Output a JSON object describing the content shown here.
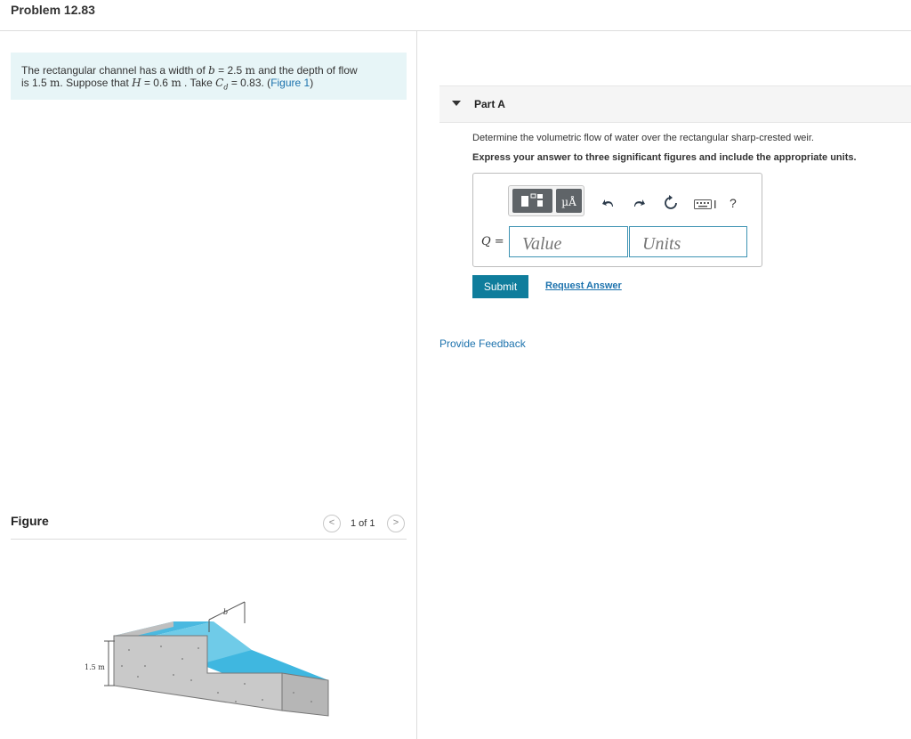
{
  "header": {
    "title": "Problem 12.83"
  },
  "problem": {
    "text_1": "The rectangular channel has a width of",
    "var_b": "b",
    "eq_b": " = 2.5 ",
    "unit_m": "m",
    "text_2": " and the depth of flow",
    "text_3": "is 1.5 ",
    "text_4": ". Suppose that ",
    "var_H": "H",
    "eq_H": " = 0.6 ",
    "text_5": " . Take ",
    "var_Cd": "C",
    "sub_d": "d",
    "eq_Cd": " = 0.83. (",
    "figure_link": "Figure 1",
    "close_paren": ")"
  },
  "figure": {
    "label": "Figure",
    "pager": "1 of 1",
    "prev_glyph": "<",
    "next_glyph": ">",
    "depth_label": "1.5 m",
    "width_label": "b"
  },
  "part_a": {
    "title": "Part A",
    "question": "Determine the volumetric flow of water over the rectangular sharp-crested weir.",
    "instruction": "Express your answer to three significant figures and include the appropriate units.",
    "toolbar": {
      "units_glyph": "µÅ",
      "help": "?"
    },
    "answer_var": "Q",
    "answer_eq": " =",
    "value_placeholder": "Value",
    "units_placeholder": "Units",
    "submit_label": "Submit",
    "request_label": "Request Answer"
  },
  "footer": {
    "feedback_label": "Provide Feedback"
  },
  "colors": {
    "accent": "#0f7d9c",
    "link": "#1c72ad",
    "statement_bg": "#e7f5f7",
    "water": "#3fb7e0"
  }
}
